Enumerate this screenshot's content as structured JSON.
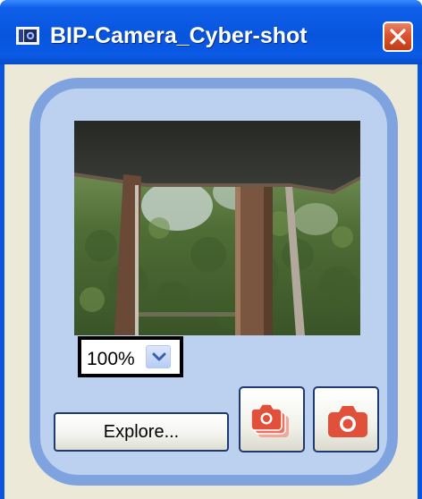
{
  "window": {
    "title": "BIP-Camera_Cyber-shot"
  },
  "preview": {
    "zoom": {
      "selected": "100%"
    }
  },
  "buttons": {
    "explore_label": "Explore..."
  },
  "colors": {
    "titlebar": "#0855dd",
    "panel_fill": "#bcd0f0",
    "panel_border": "#7fa3df",
    "camera_icon": "#e0503a",
    "close_button": "#d9542f"
  },
  "icons": {
    "app": "camera-app-icon",
    "close": "close-icon",
    "zoom_dropdown": "chevron-down-icon",
    "burst": "burst-capture-icon",
    "capture": "camera-icon"
  }
}
